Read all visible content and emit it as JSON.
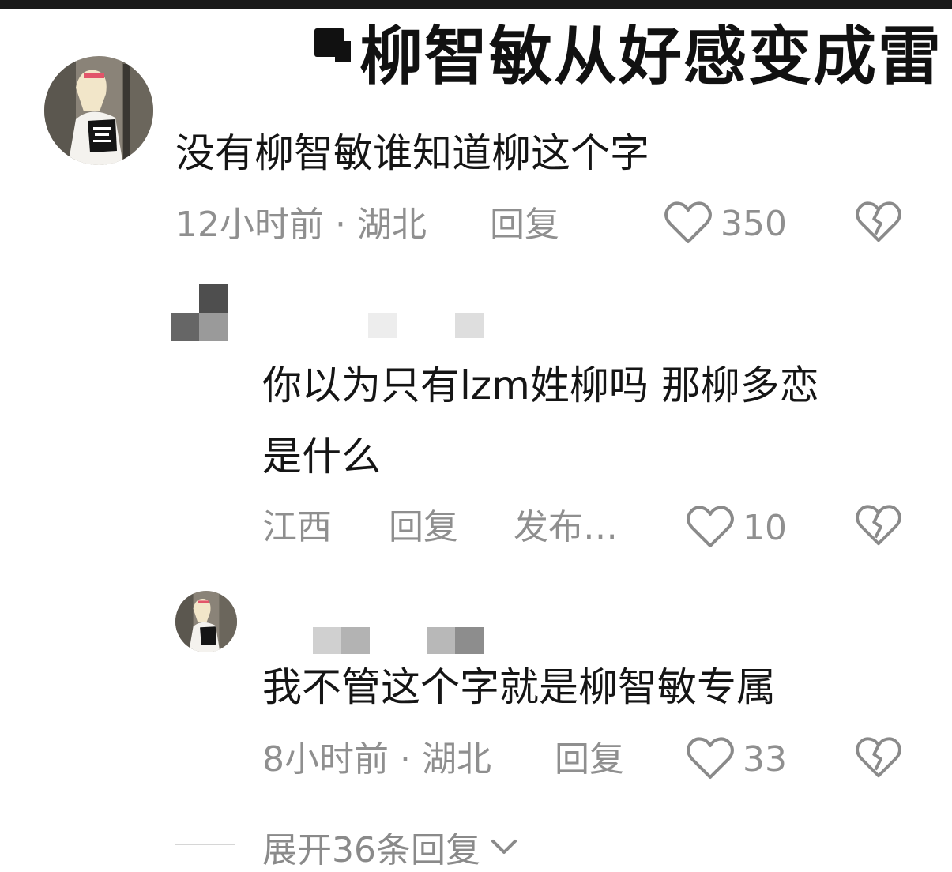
{
  "headline": "柳智敏从好感变成雷",
  "comments": [
    {
      "text": "没有柳智敏谁知道柳这个字",
      "meta": "12小时前 · 湖北",
      "reply_label": "回复",
      "likes": "350"
    },
    {
      "text_line1": "你以为只有lzm姓柳吗 那柳多恋",
      "text_line2": "是什么",
      "location": "江西",
      "reply_label": "回复",
      "extra": "发布…",
      "likes": "10"
    },
    {
      "text": "我不管这个字就是柳智敏专属",
      "meta": "8小时前 · 湖北",
      "reply_label": "回复",
      "likes": "33"
    }
  ],
  "expand_label": "展开36条回复",
  "icons": {
    "like": "heart-outline-icon",
    "dislike": "broken-heart-icon",
    "expand": "chevron-down-icon"
  },
  "colors": {
    "text": "#151515",
    "meta": "#8f8f8f",
    "icon": "#8a8a8a"
  }
}
